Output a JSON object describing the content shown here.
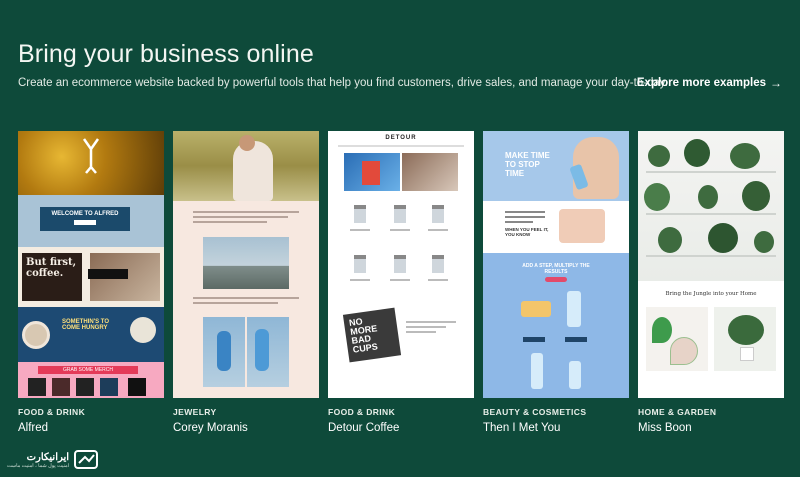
{
  "header": {
    "title": "Bring your business online",
    "subtitle": "Create an ecommerce website backed by powerful tools that help you find customers, drive sales, and manage your day-to-day.",
    "explore_label": "Explore more examples",
    "explore_icon": "arrow-right-icon"
  },
  "examples": [
    {
      "category": "FOOD & DRINK",
      "name": "Alfred"
    },
    {
      "category": "JEWELRY",
      "name": "Corey Moranis"
    },
    {
      "category": "FOOD & DRINK",
      "name": "Detour Coffee"
    },
    {
      "category": "BEAUTY & COSMETICS",
      "name": "Then I Met You"
    },
    {
      "category": "HOME & GARDEN",
      "name": "Miss Boon"
    }
  ],
  "thumb_text": {
    "alfred_welcome": "WELCOME TO ALFRED",
    "alfred_coffee": "But first, coffee.",
    "alfred_thirsty": "SOMETHIN'S TO COME HUNGRY",
    "alfred_merch": "GRAB SOME MERCH",
    "detour_logo": "DETOUR",
    "detour_cups": "NO MORE BAD CUPS",
    "tim_hero": "MAKE TIME TO STOP TIME",
    "tim_feel": "WHEN YOU FEEL IT, YOU KNOW",
    "tim_results": "ADD A STEP, MULTIPLY THE RESULTS",
    "missboon_caption": "Bring the Jungle into your Home"
  },
  "watermark": {
    "brand": "ایرانیکارت",
    "tagline": "امنیت پول شما ، امنیت ماست"
  },
  "colors": {
    "background": "#0e4a3a",
    "text": "#ffffff"
  }
}
